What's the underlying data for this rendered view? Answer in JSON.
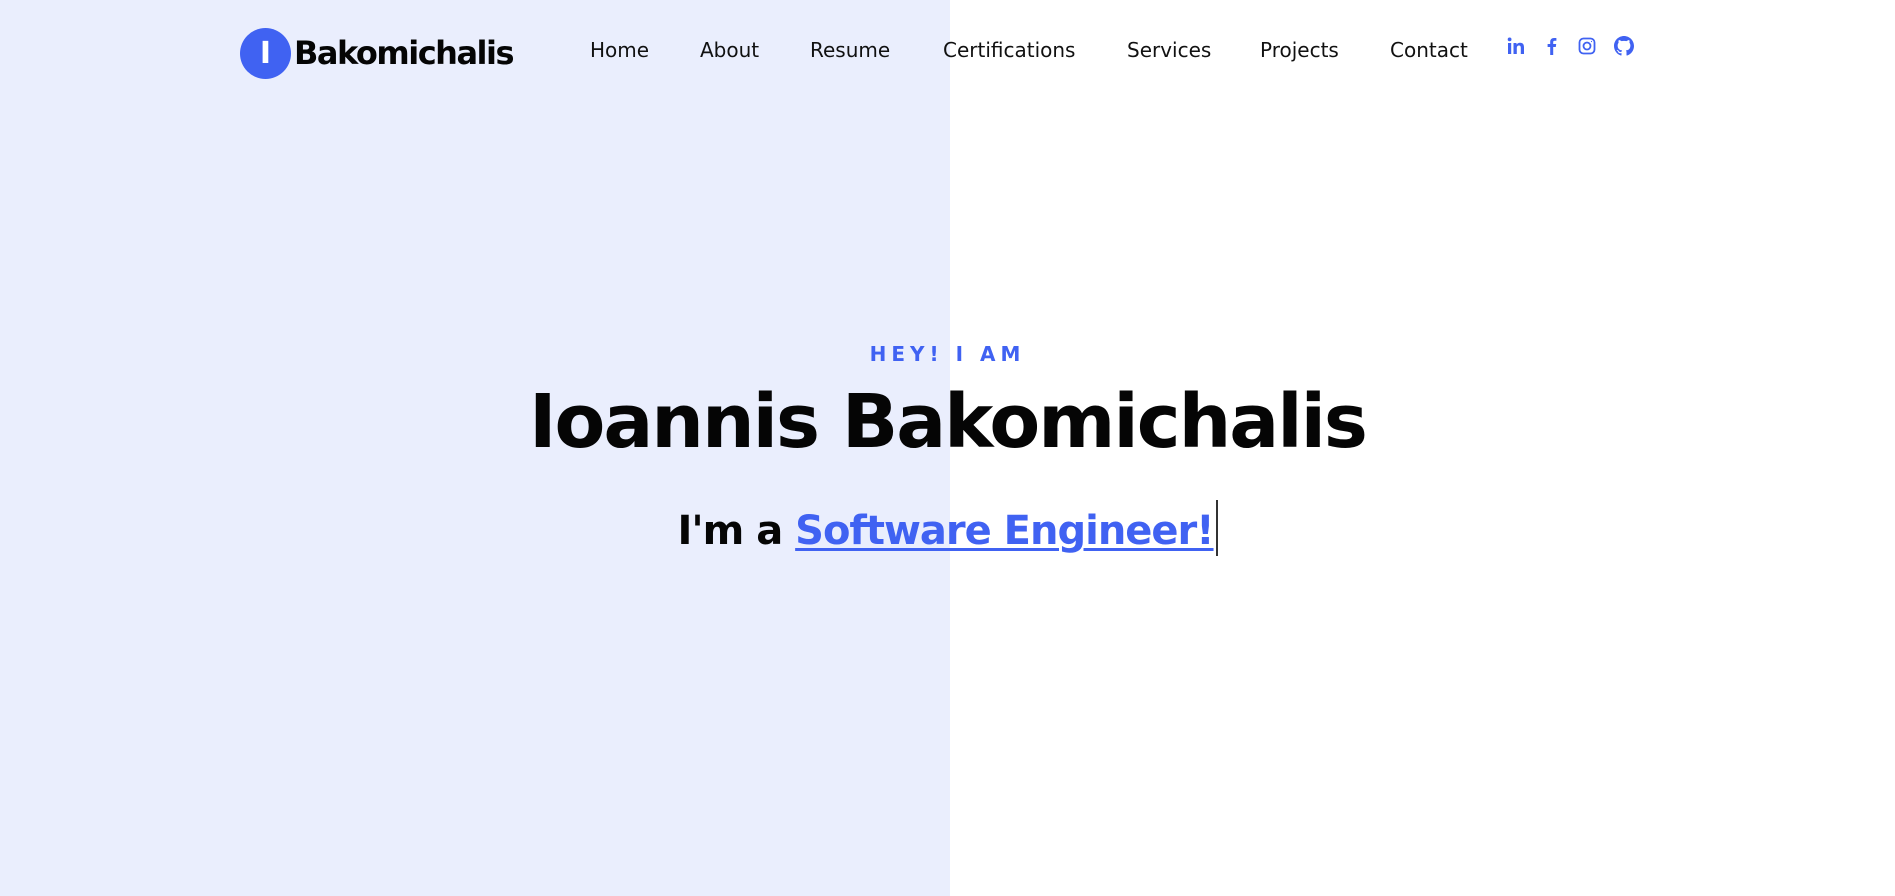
{
  "brand": {
    "initial": "I",
    "name": "Bakomichalis"
  },
  "nav": {
    "items": [
      {
        "label": "Home"
      },
      {
        "label": "About"
      },
      {
        "label": "Resume"
      },
      {
        "label": "Certifications"
      },
      {
        "label": "Services"
      },
      {
        "label": "Projects"
      },
      {
        "label": "Contact"
      }
    ]
  },
  "social": {
    "icons": [
      "linkedin-icon",
      "facebook-icon",
      "instagram-icon",
      "github-icon"
    ]
  },
  "hero": {
    "kicker": "HEY! I AM",
    "name": "Ioannis Bakomichalis",
    "role_prefix": "I'm a",
    "role_typed": "Software Engineer!"
  },
  "colors": {
    "accent": "#4062f2",
    "left_panel_bg": "#eaeefd",
    "text": "#050505"
  }
}
